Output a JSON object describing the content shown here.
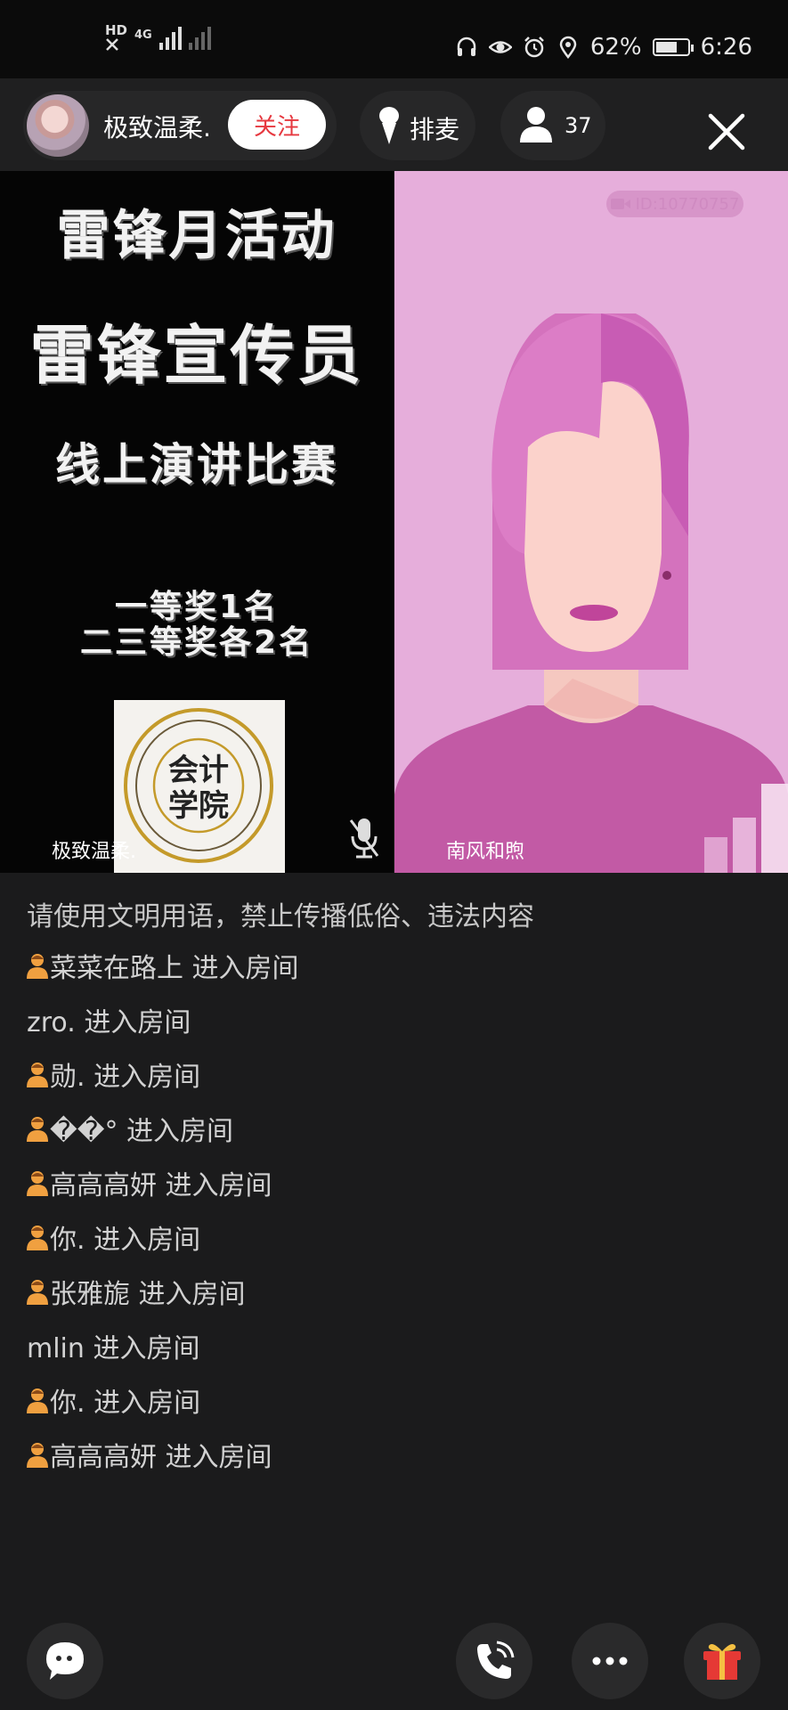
{
  "status_bar": {
    "hd_label": "HD",
    "network_label": "4G",
    "battery_percent": "62%",
    "time": "6:26",
    "icons": [
      "headphones-icon",
      "eye-icon",
      "alarm-icon",
      "location-icon",
      "battery-icon"
    ]
  },
  "header": {
    "host_name": "极致温柔.",
    "follow_label": "关注",
    "queue_label": "排麦",
    "viewer_count": "37"
  },
  "video": {
    "left": {
      "poster_lines": [
        "雷锋月活动",
        "雷锋宣传员",
        "线上演讲比赛",
        "一等奖1名",
        "二三等奖各2名"
      ],
      "seal_text": "会计学院",
      "name": "极致温柔."
    },
    "right": {
      "id_badge": "ID:10770757",
      "name": "南风和煦"
    }
  },
  "chat": {
    "notice": "请使用文明用语，禁止传播低俗、违法内容",
    "messages": [
      {
        "text": "菜菜在路上 进入房间",
        "icon": true
      },
      {
        "text": "zro. 进入房间",
        "icon": false
      },
      {
        "text": "勋. 进入房间",
        "icon": true
      },
      {
        "text": "��° 进入房间",
        "icon": true
      },
      {
        "text": "高高高妍 进入房间",
        "icon": true
      },
      {
        "text": "你. 进入房间",
        "icon": true
      },
      {
        "text": "张雅旎 进入房间",
        "icon": true
      },
      {
        "text": "mlin 进入房间",
        "icon": false
      },
      {
        "text": "你. 进入房间",
        "icon": true
      },
      {
        "text": "高高高妍 进入房间",
        "icon": true
      }
    ]
  },
  "colors": {
    "background": "#1b1b1c",
    "follow_text": "#e6383f",
    "right_pane": "#e6aedb",
    "user_icon": "#f0a040",
    "gift": "#e53935"
  }
}
